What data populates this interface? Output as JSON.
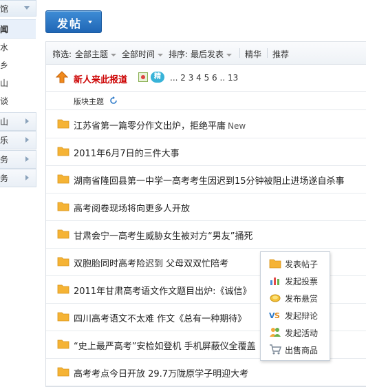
{
  "sidebar": {
    "top_label": "馆",
    "items": [
      {
        "label": "闻",
        "active": true
      },
      {
        "label": "水",
        "active": false
      },
      {
        "label": "乡",
        "active": false
      },
      {
        "label": "山",
        "active": false
      },
      {
        "label": "谈",
        "active": false
      }
    ],
    "groups": [
      "山",
      "乐",
      "务",
      "务"
    ]
  },
  "toolbar": {
    "post_label": "发帖"
  },
  "filter": {
    "label": "筛选:",
    "all_topics": "全部主题",
    "all_time": "全部时间",
    "sort_label": "排序:",
    "sort_value": "最后发表",
    "digest": "精华",
    "recommend": "推荐"
  },
  "sticky": {
    "title": "新人来此报道",
    "badge": "精",
    "pages": "... 2 3 4 5 6 .. 13"
  },
  "column_header": "版块主题",
  "threads": [
    {
      "title": "江苏省第一篇零分作文出炉，拒绝平庸",
      "new": "New"
    },
    {
      "title": "2011年6月7日的三件大事",
      "new": ""
    },
    {
      "title": "湖南省隆回县第一中学一高考考生因迟到15分钟被阻止进场遂自杀事",
      "new": ""
    },
    {
      "title": "高考阅卷现场将向更多人开放",
      "new": ""
    },
    {
      "title": "甘肃会宁一高考生威胁女生被对方“男友”捅死",
      "new": ""
    },
    {
      "title": "双胞胎同时高考险迟到 父母双双忙陪考",
      "new": ""
    },
    {
      "title": "2011年甘肃高考语文作文题目出炉:《诚信》",
      "new": ""
    },
    {
      "title": "四川高考语文不太难 作文《总有一种期待》",
      "new": ""
    },
    {
      "title": "“史上最严高考”安检如登机 手机屏蔽仪全覆盖",
      "new": ""
    },
    {
      "title": "高考考点今日开放 29.7万陇原学子明迎大考",
      "new": ""
    }
  ],
  "popup_menu": [
    {
      "label": "发表帖子",
      "icon": "folder-icon"
    },
    {
      "label": "发起投票",
      "icon": "poll-chart-icon"
    },
    {
      "label": "发布悬赏",
      "icon": "reward-coin-icon"
    },
    {
      "label": "发起辩论",
      "icon": "vs-debate-icon"
    },
    {
      "label": "发起活动",
      "icon": "activity-people-icon"
    },
    {
      "label": "出售商品",
      "icon": "shopping-cart-icon"
    }
  ],
  "colors": {
    "accent_blue": "#2a78c8",
    "sticky_red": "#cc0000",
    "folder_yellow": "#f5b335"
  }
}
